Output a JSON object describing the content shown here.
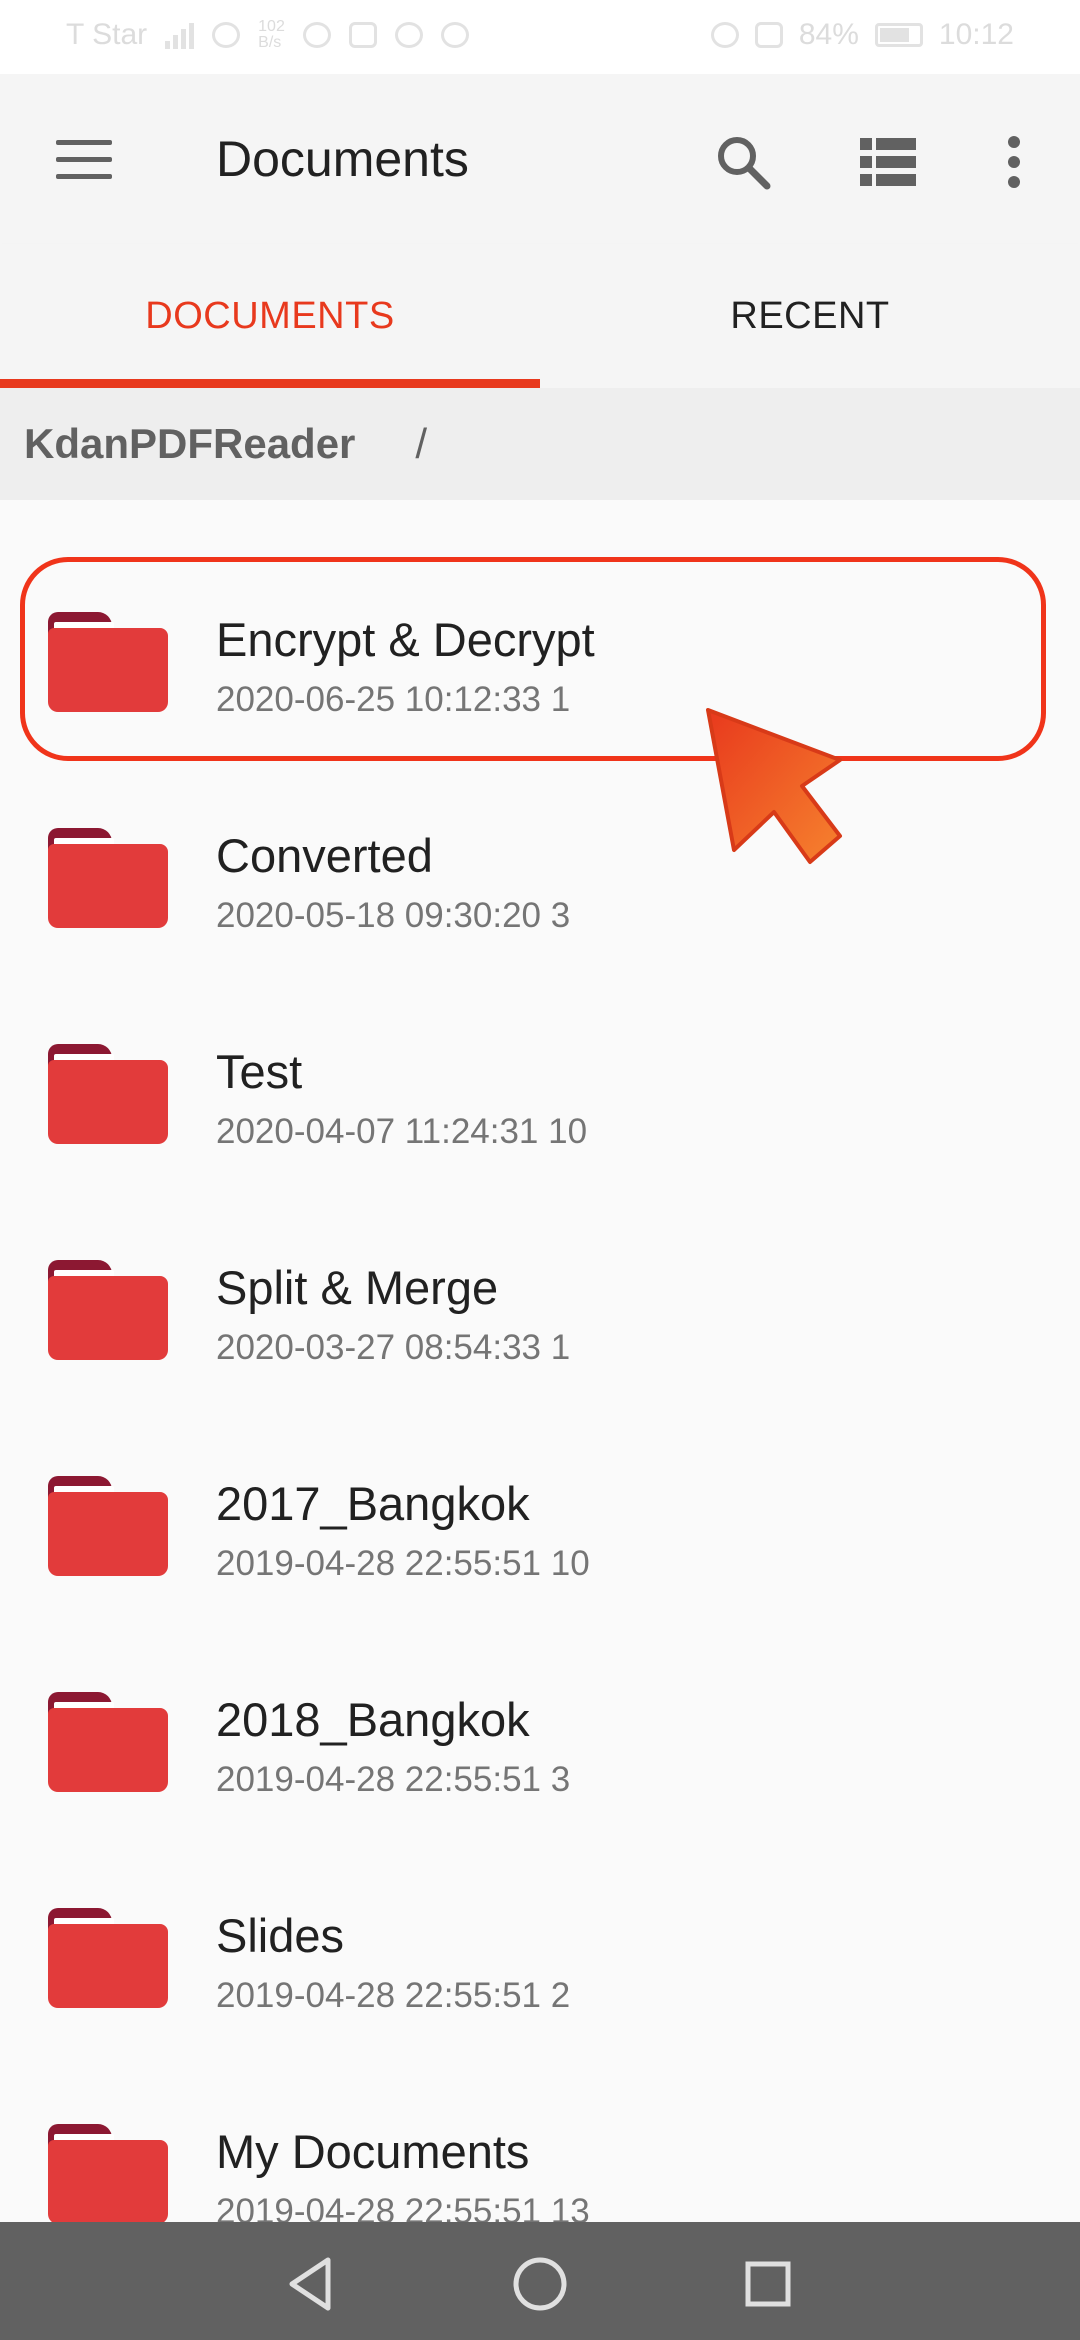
{
  "status_bar": {
    "carrier": "T Star",
    "speed_top": "102",
    "speed_bottom": "B/s",
    "battery": "84%",
    "time": "10:12"
  },
  "toolbar": {
    "title": "Documents",
    "menu_icon": "hamburger-menu-icon",
    "search_icon": "search-icon",
    "list_icon": "list-view-icon",
    "more_icon": "more-vertical-icon"
  },
  "tabs": [
    {
      "label": "DOCUMENTS",
      "active": true
    },
    {
      "label": "RECENT",
      "active": false
    }
  ],
  "breadcrumb": {
    "root": "KdanPDFReader",
    "separator": "/"
  },
  "folders": [
    {
      "name": "Encrypt & Decrypt",
      "modified": "2020-06-25 10:12:33",
      "count": "1"
    },
    {
      "name": "Converted",
      "modified": "2020-05-18 09:30:20",
      "count": "3"
    },
    {
      "name": "Test",
      "modified": "2020-04-07 11:24:31",
      "count": "10"
    },
    {
      "name": "Split & Merge",
      "modified": "2020-03-27 08:54:33",
      "count": "1"
    },
    {
      "name": "2017_Bangkok",
      "modified": "2019-04-28 22:55:51",
      "count": "10"
    },
    {
      "name": "2018_Bangkok",
      "modified": "2019-04-28 22:55:51",
      "count": "3"
    },
    {
      "name": "Slides",
      "modified": "2019-04-28 22:55:51",
      "count": "2"
    },
    {
      "name": "My Documents",
      "modified": "2019-04-28 22:55:51",
      "count": "13"
    }
  ],
  "colors": {
    "accent": "#e8391d",
    "folder_body": "#e23b3b",
    "folder_tab": "#8c1832",
    "highlight": "#f0341a",
    "nav_bar": "#616161"
  },
  "nav_bar": {
    "back_icon": "back-triangle-icon",
    "home_icon": "home-circle-icon",
    "recents_icon": "recents-square-icon"
  }
}
